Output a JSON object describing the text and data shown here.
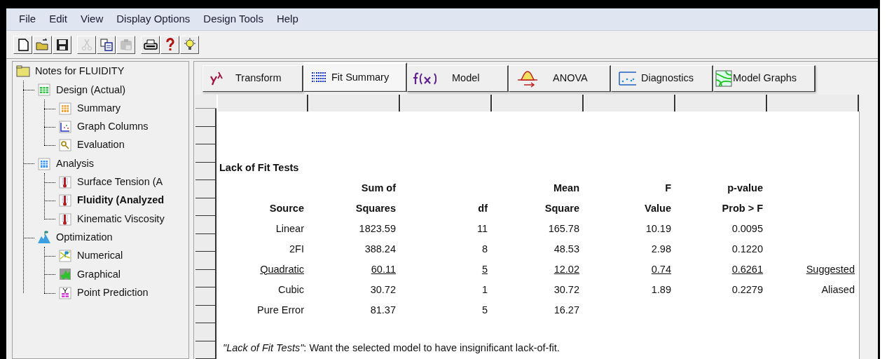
{
  "menu": [
    "File",
    "Edit",
    "View",
    "Display Options",
    "Design Tools",
    "Help"
  ],
  "toolbar": [
    [
      {
        "kind": "new",
        "disabled": false
      },
      {
        "kind": "open",
        "disabled": false
      },
      {
        "kind": "save",
        "disabled": false
      }
    ],
    [
      {
        "kind": "cut",
        "disabled": true
      },
      {
        "kind": "copy",
        "disabled": false
      },
      {
        "kind": "paste",
        "disabled": true
      }
    ],
    [
      {
        "kind": "print",
        "disabled": false
      },
      {
        "kind": "help",
        "disabled": false
      },
      {
        "kind": "tip",
        "disabled": false
      }
    ]
  ],
  "tree": [
    {
      "label": "Notes for FLUIDITY",
      "kind": "folder",
      "selected": false,
      "children": [
        {
          "label": "Design (Actual)",
          "kind": "grid",
          "selected": false,
          "children": [
            {
              "label": "Summary",
              "kind": "summary",
              "selected": false
            },
            {
              "label": "Graph Columns",
              "kind": "graph",
              "selected": false
            },
            {
              "label": "Evaluation",
              "kind": "eval",
              "selected": false
            }
          ]
        },
        {
          "label": "Analysis",
          "kind": "calc",
          "selected": false,
          "children": [
            {
              "label": "Surface Tension (A",
              "kind": "thermo",
              "selected": false
            },
            {
              "label": "Fluidity (Analyzed",
              "kind": "thermo",
              "selected": true
            },
            {
              "label": "Kinematic Viscosity",
              "kind": "thermo",
              "selected": false
            }
          ]
        },
        {
          "label": "Optimization",
          "kind": "mountain",
          "selected": false,
          "children": [
            {
              "label": "Numerical",
              "kind": "numerical",
              "selected": false
            },
            {
              "label": "Graphical",
              "kind": "graphical",
              "selected": false
            },
            {
              "label": "Point Prediction",
              "kind": "point",
              "selected": false
            }
          ]
        }
      ]
    }
  ],
  "tabs": [
    {
      "label": "Transform",
      "kind": "transform",
      "selected": false
    },
    {
      "label": "Fit Summary",
      "kind": "list",
      "selected": true
    },
    {
      "label": "Model",
      "kind": "fx",
      "selected": false
    },
    {
      "label": "ANOVA",
      "kind": "anova",
      "selected": false
    },
    {
      "label": "Diagnostics",
      "kind": "diag",
      "selected": false
    },
    {
      "label": "Model Graphs",
      "kind": "contour",
      "selected": false
    }
  ],
  "report": {
    "title": "Lack of Fit Tests",
    "columns": [
      {
        "bottom": "Source"
      },
      {
        "top": "Sum of",
        "bottom": "Squares"
      },
      {
        "bottom": "df"
      },
      {
        "top": "Mean",
        "bottom": "Square"
      },
      {
        "top": "F",
        "bottom": "Value"
      },
      {
        "top": "p-value",
        "bottom": "Prob > F"
      }
    ],
    "rows": [
      {
        "selected": false,
        "cells": [
          "Linear",
          "1823.59",
          "11",
          "165.78",
          "10.19",
          "0.0095"
        ]
      },
      {
        "selected": false,
        "cells": [
          "2FI",
          "388.24",
          "8",
          "48.53",
          "2.98",
          "0.1220"
        ]
      },
      {
        "selected": true,
        "cells": [
          "Quadratic",
          "60.11",
          "5",
          "12.02",
          "0.74",
          "0.6261"
        ],
        "remark": "Suggested"
      },
      {
        "selected": false,
        "cells": [
          "Cubic",
          "30.72",
          "1",
          "30.72",
          "1.89",
          "0.2279"
        ],
        "remark": "Aliased"
      },
      {
        "selected": false,
        "cells": [
          "Pure Error",
          "81.37",
          "5",
          "16.27"
        ]
      }
    ],
    "note": "*\"Lack of Fit Tests\"*:  Want the selected model to have insignificant lack-of-fit."
  }
}
